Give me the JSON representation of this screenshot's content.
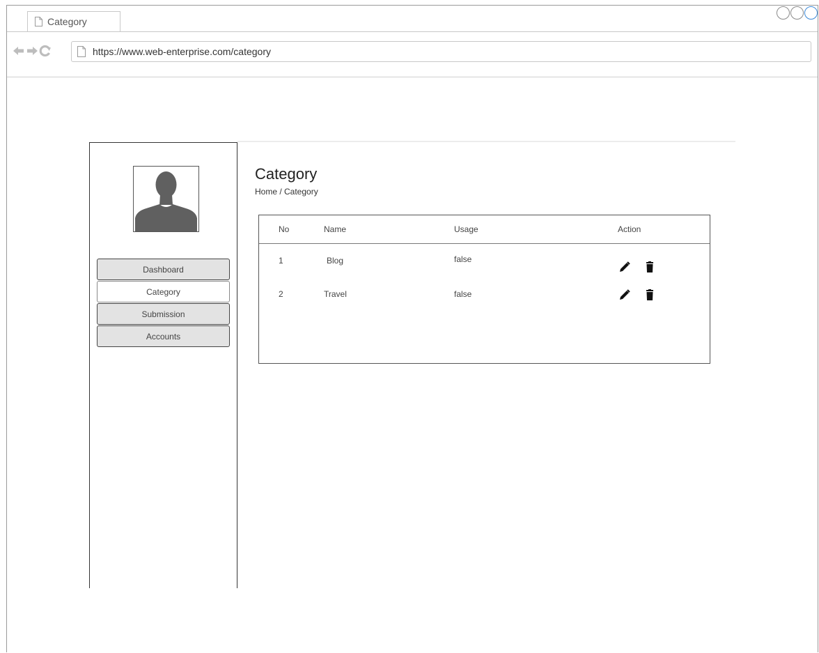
{
  "browser": {
    "tab_title": "Category",
    "url": "https://www.web-enterprise.com/category"
  },
  "icons": {
    "tab": "document-icon",
    "back": "back-arrow-icon",
    "forward": "forward-arrow-icon",
    "reload": "reload-icon",
    "url": "document-icon",
    "avatar": "user-silhouette-icon",
    "edit": "pencil-icon",
    "delete": "trash-icon"
  },
  "colors": {
    "accent_window_control": "#3a88d8",
    "menu_bg": "#e3e3e3",
    "menu_active_bg": "#ffffff"
  },
  "sidebar": {
    "items": [
      {
        "label": "Dashboard",
        "active": false
      },
      {
        "label": "Category",
        "active": true
      },
      {
        "label": "Submission",
        "active": false
      },
      {
        "label": "Accounts",
        "active": false
      }
    ]
  },
  "main": {
    "title": "Category",
    "breadcrumb": "Home / Category"
  },
  "table": {
    "headers": {
      "no": "No",
      "name": "Name",
      "usage": "Usage",
      "action": "Action"
    },
    "rows": [
      {
        "no": "1",
        "name": "Blog",
        "usage": "false"
      },
      {
        "no": "2",
        "name": "Travel",
        "usage": "false"
      }
    ]
  }
}
